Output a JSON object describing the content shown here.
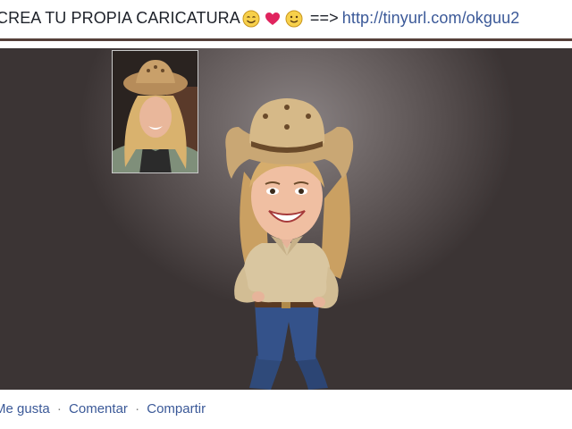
{
  "post": {
    "text": "CREA TU PROPIA CARICATURA",
    "emojis": [
      "smiling-face-icon",
      "heart-icon",
      "smiling-face-icon"
    ],
    "arrow": "==>",
    "link_text": "http://tinyurl.com/okguu2"
  },
  "actions": {
    "like": "Me gusta",
    "separator": "·",
    "comment": "Comentar",
    "share": "Compartir"
  },
  "colors": {
    "link": "#3b5998",
    "heart": "#e0245e",
    "header_border": "#55403a",
    "photo_background": "#544c4c"
  }
}
